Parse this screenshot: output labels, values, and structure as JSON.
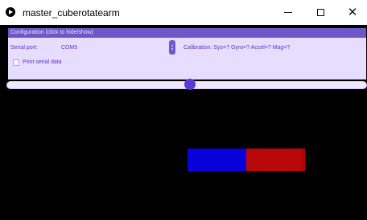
{
  "window": {
    "title": "master_cuberotatearm",
    "controls": {
      "minimize_icon": "minimize-icon",
      "maximize_icon": "maximize-icon",
      "close_icon": "close-icon",
      "close_glyph": "✕"
    }
  },
  "config": {
    "header": "Configuration (click to hide/show)",
    "serial_port_label": "Serial port:",
    "serial_port_value": "COM5",
    "calibration_text": "Calibration: Sys=? Gyro=? Accel=? Mag=?",
    "print_serial_label": "Print serial data",
    "print_serial_checked": false
  },
  "slider": {
    "value_fraction": 0.51
  },
  "colors": {
    "titlebar_bg": "#ffffff",
    "canvas_bg": "#000000",
    "config_header": "#6f55c7",
    "config_panel": "#e7ddff",
    "config_text": "#5a34c4",
    "slider_thumb": "#5b39d5",
    "cube_blue": "#0a00d9",
    "cube_red": "#b8080a"
  }
}
